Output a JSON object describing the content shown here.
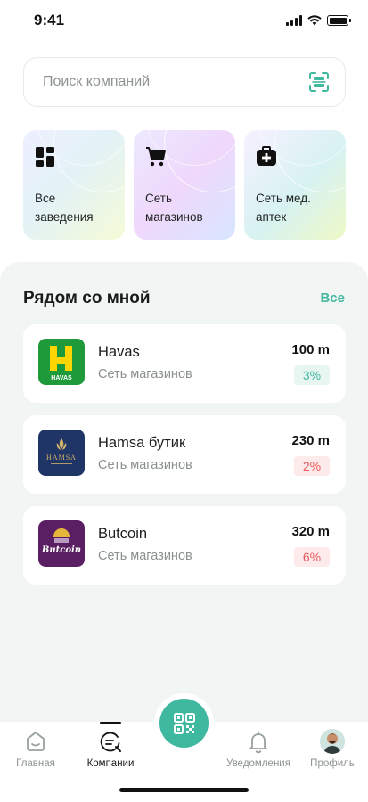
{
  "status_bar": {
    "time": "9:41"
  },
  "search": {
    "placeholder": "Поиск компаний"
  },
  "categories": [
    {
      "label": "Все\nзаведения",
      "icon": "grid-icon"
    },
    {
      "label": "Сеть\nмагазинов",
      "icon": "cart-icon"
    },
    {
      "label": "Сеть мед.\nаптек",
      "icon": "medkit-icon"
    }
  ],
  "nearby": {
    "title": "Рядом со мной",
    "see_all": "Все",
    "shops": [
      {
        "name": "Havas",
        "type": "Сеть магазинов",
        "distance": "100 m",
        "cashback": "3%",
        "badge_color": "#45b8a2",
        "logo_text": "HAVAS",
        "logo_letter": "H"
      },
      {
        "name": "Hamsa бутик",
        "type": "Сеть магазинов",
        "distance": "230 m",
        "cashback": "2%",
        "badge_color": "#ec5b5b",
        "logo_text": "HAMSA"
      },
      {
        "name": "Butcoin",
        "type": "Сеть магазинов",
        "distance": "320 m",
        "cashback": "6%",
        "badge_color": "#ec5b5b",
        "logo_text": "Butcoin"
      }
    ]
  },
  "bottom_nav": {
    "items": [
      {
        "label": "Главная",
        "icon": "home-icon"
      },
      {
        "label": "Компании",
        "icon": "companies-icon"
      },
      {
        "label": "Уведомления",
        "icon": "bell-icon"
      },
      {
        "label": "Профиль",
        "icon": "avatar"
      }
    ],
    "active_index": 1,
    "fab_icon": "qr-icon"
  },
  "colors": {
    "accent": "#3fb8a0",
    "section_bg": "#f1f5f4",
    "badge_green": "#45b8a2",
    "badge_red": "#ec5b5b",
    "havas_green": "#1e9a3b",
    "hamsa_navy": "#1f3566",
    "butcoin_purple": "#5a1f63"
  }
}
